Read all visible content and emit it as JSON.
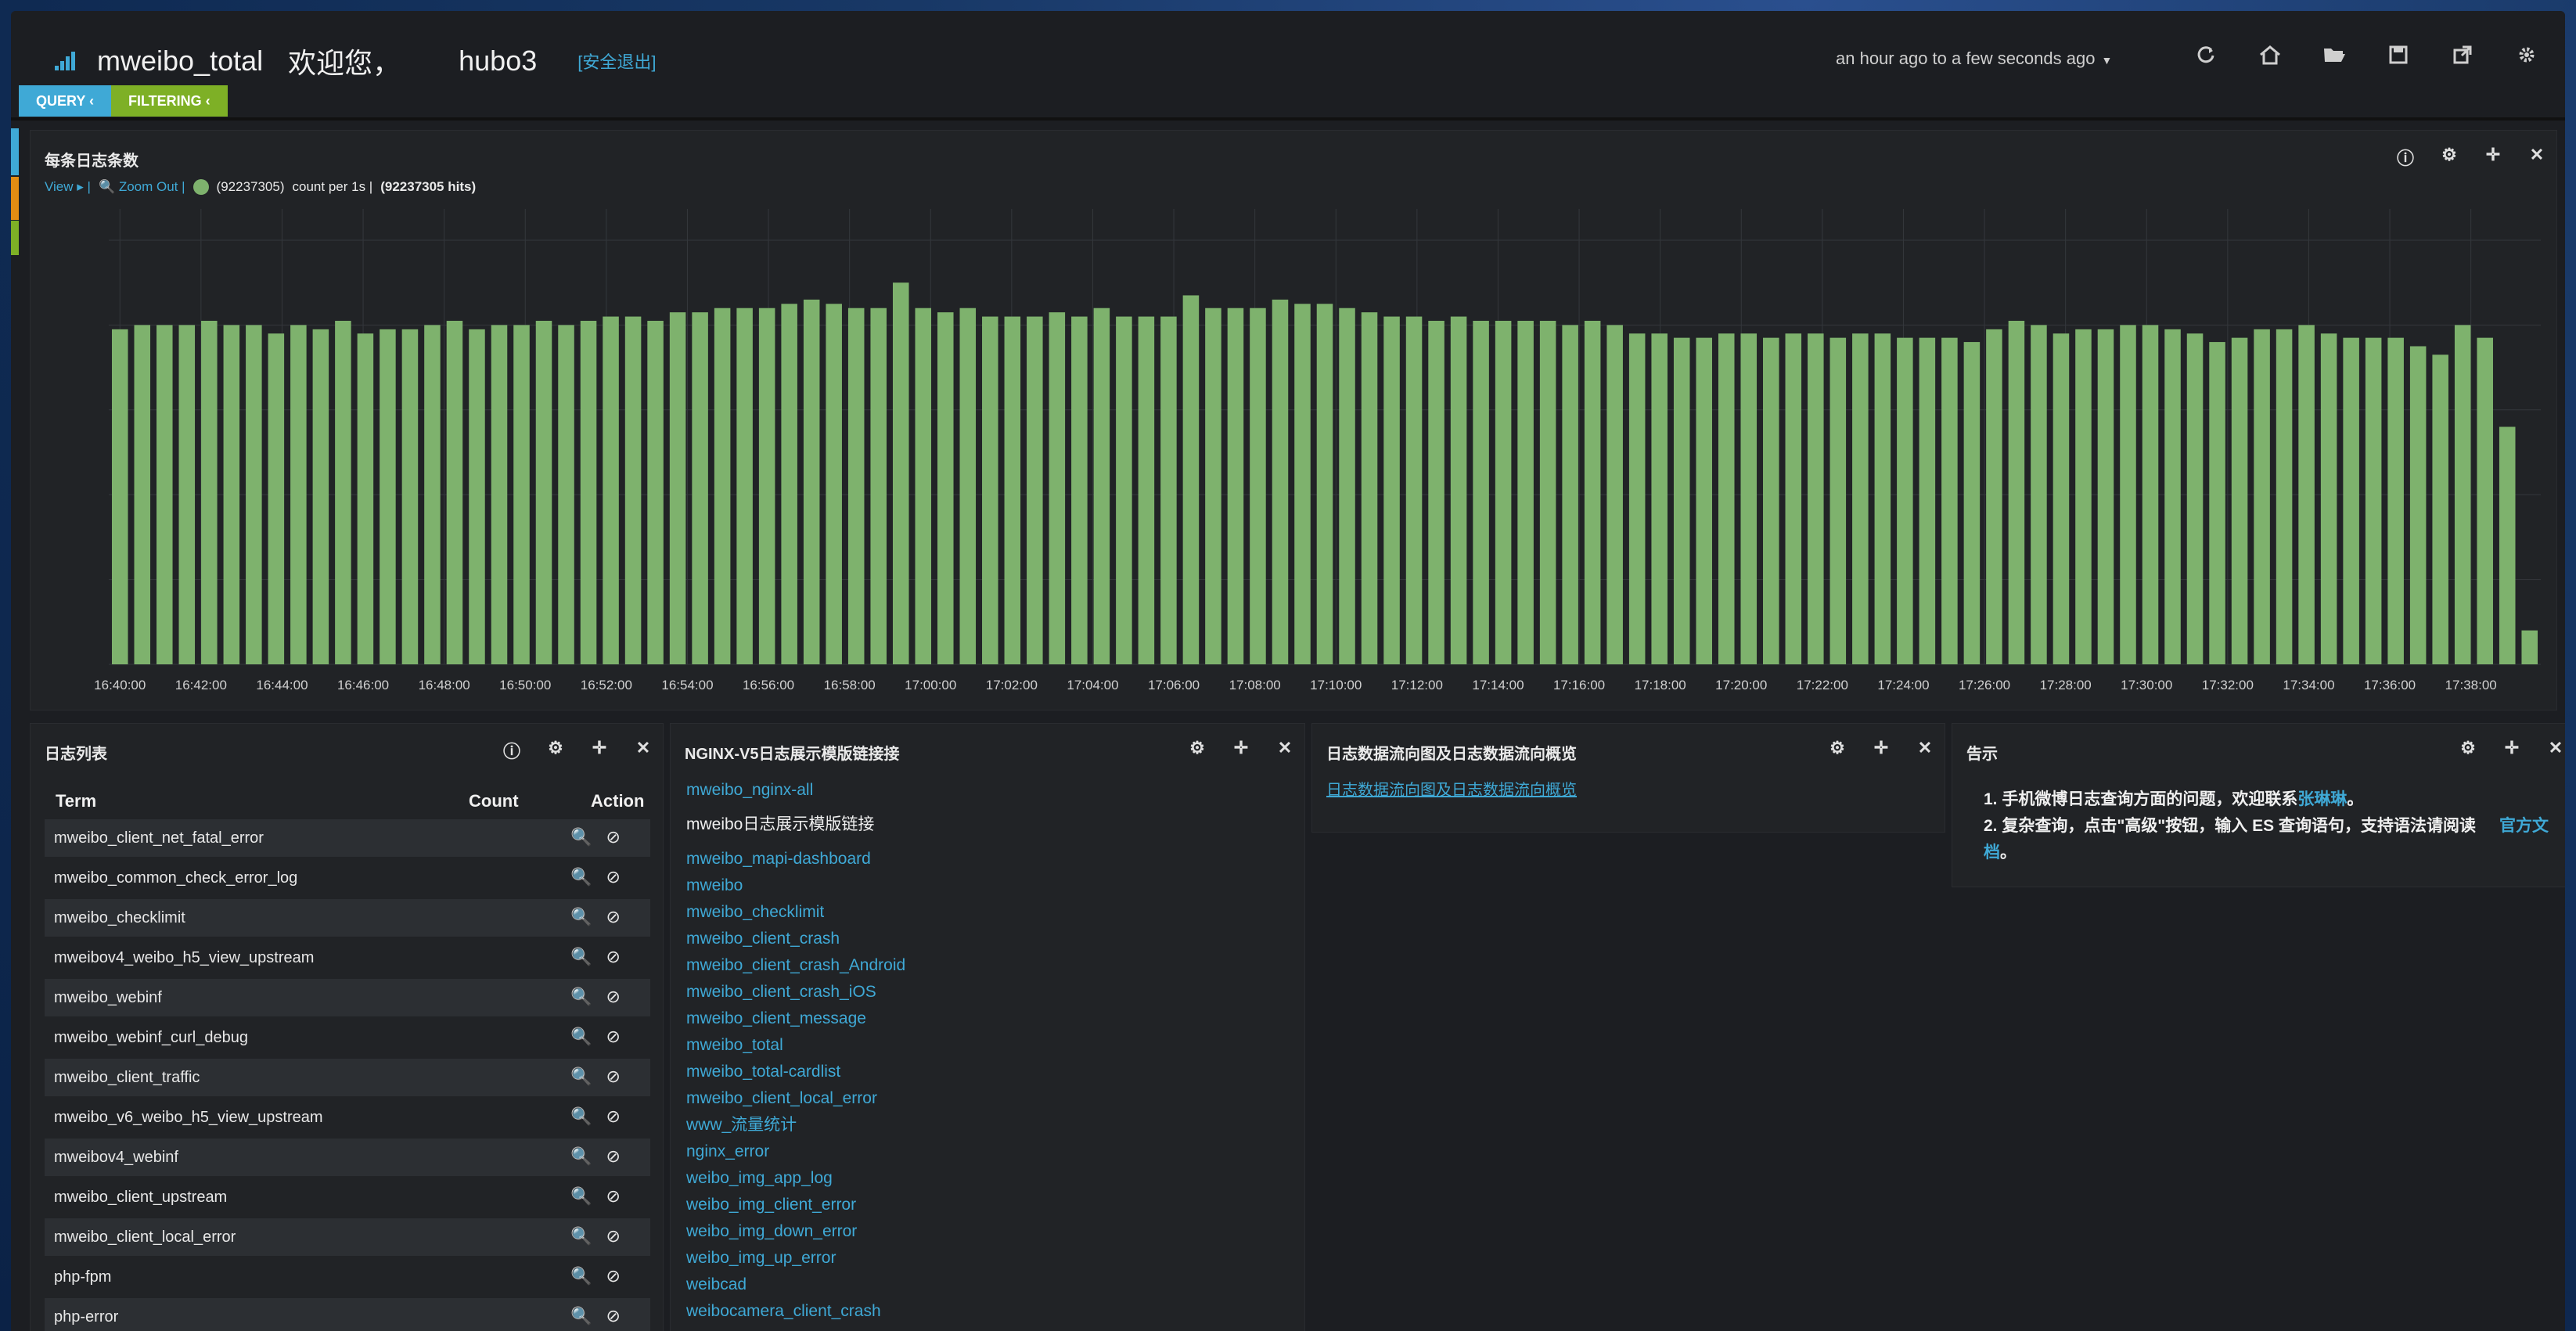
{
  "header": {
    "title": "mweibo_total",
    "welcome": "欢迎您，",
    "user": "hubo3",
    "logout": "[安全退出]",
    "timerange": "an hour ago to a few seconds ago",
    "icons": [
      "refresh-icon",
      "home-icon",
      "folder-icon",
      "save-icon",
      "share-icon",
      "gear-icon"
    ]
  },
  "pills": {
    "query": "QUERY ‹",
    "filter": "FILTERING ‹"
  },
  "histogram": {
    "title": "每条日志条数",
    "view": "View ▸ |",
    "zoom": "🔍 Zoom Out |",
    "legend_count": "(92237305)",
    "legend_text": "count per 1s |",
    "hits": "(92237305 hits)"
  },
  "chart_data": {
    "type": "bar",
    "x": [
      "16:40:00",
      "16:42:00",
      "16:44:00",
      "16:46:00",
      "16:48:00",
      "16:50:00",
      "16:52:00",
      "16:54:00",
      "16:56:00",
      "16:58:00",
      "17:00:00",
      "17:02:00",
      "17:04:00",
      "17:06:00",
      "17:08:00",
      "17:10:00",
      "17:12:00",
      "17:14:00",
      "17:16:00",
      "17:18:00",
      "17:20:00",
      "17:22:00",
      "17:24:00",
      "17:26:00",
      "17:28:00",
      "17:30:00",
      "17:32:00",
      "17:34:00",
      "17:36:00",
      "17:38:00"
    ],
    "values": [
      0.79,
      0.8,
      0.8,
      0.8,
      0.81,
      0.8,
      0.8,
      0.78,
      0.8,
      0.79,
      0.81,
      0.78,
      0.79,
      0.79,
      0.8,
      0.81,
      0.79,
      0.8,
      0.8,
      0.81,
      0.8,
      0.81,
      0.82,
      0.82,
      0.81,
      0.83,
      0.83,
      0.84,
      0.84,
      0.84,
      0.85,
      0.86,
      0.85,
      0.84,
      0.84,
      0.9,
      0.84,
      0.83,
      0.84,
      0.82,
      0.82,
      0.82,
      0.83,
      0.82,
      0.84,
      0.82,
      0.82,
      0.82,
      0.87,
      0.84,
      0.84,
      0.84,
      0.86,
      0.85,
      0.85,
      0.84,
      0.83,
      0.82,
      0.82,
      0.81,
      0.82,
      0.81,
      0.81,
      0.81,
      0.81,
      0.8,
      0.81,
      0.8,
      0.78,
      0.78,
      0.77,
      0.77,
      0.78,
      0.78,
      0.77,
      0.78,
      0.78,
      0.77,
      0.78,
      0.78,
      0.77,
      0.77,
      0.77,
      0.76,
      0.79,
      0.81,
      0.8,
      0.78,
      0.79,
      0.79,
      0.8,
      0.8,
      0.79,
      0.78,
      0.76,
      0.77,
      0.79,
      0.79,
      0.8,
      0.78,
      0.77,
      0.77,
      0.77,
      0.75,
      0.73,
      0.8,
      0.77,
      0.56,
      0.08
    ],
    "ylim": [
      0,
      1.0
    ],
    "grid": true
  },
  "terms": {
    "title": "日志列表",
    "headers": {
      "term": "Term",
      "count": "Count",
      "action": "Action"
    },
    "rows": [
      "mweibo_client_net_fatal_error",
      "mweibo_common_check_error_log",
      "mweibo_checklimit",
      "mweibov4_weibo_h5_view_upstream",
      "mweibo_webinf",
      "mweibo_webinf_curl_debug",
      "mweibo_client_traffic",
      "mweibo_v6_weibo_h5_view_upstream",
      "mweibov4_webinf",
      "mweibo_client_upstream",
      "mweibo_client_local_error",
      "php-fpm",
      "php-error"
    ],
    "action": "🔍 ⊘"
  },
  "nginx": {
    "title": "NGINX-V5日志展示模版链接接",
    "first": "mweibo_nginx-all",
    "section": "mweibo日志展示模版链接",
    "links": [
      "mweibo_mapi-dashboard",
      "mweibo",
      "mweibo_checklimit",
      "mweibo_client_crash",
      "mweibo_client_crash_Android",
      "mweibo_client_crash_iOS",
      "mweibo_client_message",
      "mweibo_total",
      "mweibo_total-cardlist",
      "mweibo_client_local_error",
      "www_流量统计",
      "nginx_error",
      "weibo_img_app_log",
      "weibo_img_client_error",
      "weibo_img_down_error",
      "weibo_img_up_error",
      "weibcad",
      "weibocamera_client_crash"
    ]
  },
  "flow": {
    "title": "日志数据流向图及日志数据流向概览",
    "link": "日志数据流向图及日志数据流向概览"
  },
  "notice": {
    "title": "告示",
    "item1_prefix": "1. 手机微博日志查询方面的问题，欢迎联系",
    "item1_link": "张琳琳",
    "item1_suffix": "。",
    "item2_prefix": "2. 复杂查询，点击\"高级\"按钮，输入 ES 查询语句，支持语法请阅读",
    "item2_link": "官方文档",
    "item2_suffix": "。"
  }
}
